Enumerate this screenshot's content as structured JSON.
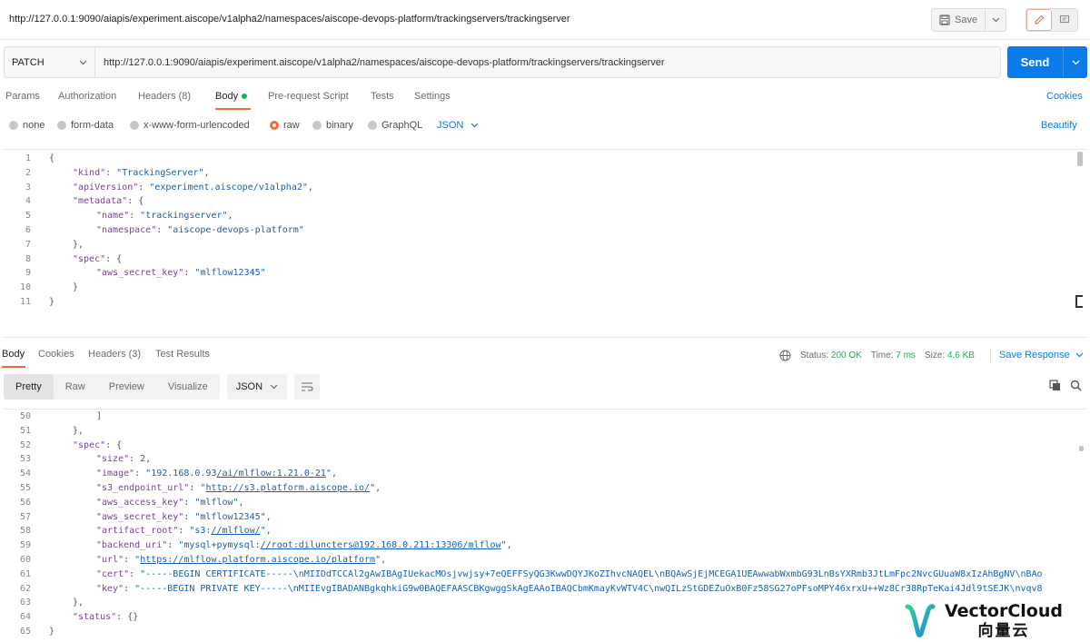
{
  "window": {
    "title": "http://127.0.0.1:9090/aiapis/experiment.aiscope/v1alpha2/namespaces/aiscope-devops-platform/trackingservers/trackingserver",
    "save_label": "Save"
  },
  "request": {
    "method": "PATCH",
    "url": "http://127.0.0.1:9090/aiapis/experiment.aiscope/v1alpha2/namespaces/aiscope-devops-platform/trackingservers/trackingserver",
    "send_label": "Send",
    "tabs": [
      "Params",
      "Authorization",
      "Headers (8)",
      "Body",
      "Pre-request Script",
      "Tests",
      "Settings"
    ],
    "active_tab": "Body",
    "cookies_label": "Cookies",
    "body_types": [
      "none",
      "form-data",
      "x-www-form-urlencoded",
      "raw",
      "binary",
      "GraphQL"
    ],
    "selected_body_type": "raw",
    "format": "JSON",
    "beautify_label": "Beautify"
  },
  "editor_lines": [
    {
      "n": "1",
      "indent": 0,
      "parts": [
        [
          "p",
          "{"
        ]
      ]
    },
    {
      "n": "2",
      "indent": 1,
      "parts": [
        [
          "k",
          "\"kind\""
        ],
        [
          "p",
          ": "
        ],
        [
          "s",
          "\"TrackingServer\""
        ],
        [
          "p",
          ","
        ]
      ]
    },
    {
      "n": "3",
      "indent": 1,
      "parts": [
        [
          "k",
          "\"apiVersion\""
        ],
        [
          "p",
          ": "
        ],
        [
          "s",
          "\"experiment.aiscope/v1alpha2\""
        ],
        [
          "p",
          ","
        ]
      ]
    },
    {
      "n": "4",
      "indent": 1,
      "parts": [
        [
          "k",
          "\"metadata\""
        ],
        [
          "p",
          ": {"
        ]
      ]
    },
    {
      "n": "5",
      "indent": 2,
      "parts": [
        [
          "k",
          "\"name\""
        ],
        [
          "p",
          ": "
        ],
        [
          "s",
          "\"trackingserver\""
        ],
        [
          "p",
          ","
        ]
      ]
    },
    {
      "n": "6",
      "indent": 2,
      "parts": [
        [
          "k",
          "\"namespace\""
        ],
        [
          "p",
          ": "
        ],
        [
          "s",
          "\"aiscope-devops-platform\""
        ]
      ]
    },
    {
      "n": "7",
      "indent": 1,
      "parts": [
        [
          "p",
          "},"
        ]
      ]
    },
    {
      "n": "8",
      "indent": 1,
      "parts": [
        [
          "k",
          "\"spec\""
        ],
        [
          "p",
          ": {"
        ]
      ]
    },
    {
      "n": "9",
      "indent": 2,
      "parts": [
        [
          "k",
          "\"aws_secret_key\""
        ],
        [
          "p",
          ": "
        ],
        [
          "s",
          "\"mlflow12345\""
        ]
      ]
    },
    {
      "n": "10",
      "indent": 1,
      "parts": [
        [
          "p",
          "}"
        ]
      ]
    },
    {
      "n": "11",
      "indent": 0,
      "parts": [
        [
          "p",
          "}"
        ]
      ]
    }
  ],
  "response": {
    "tabs": [
      "Body",
      "Cookies",
      "Headers (3)",
      "Test Results"
    ],
    "active_tab": "Body",
    "status_label": "Status:",
    "status_value": "200 OK",
    "time_label": "Time:",
    "time_value": "7 ms",
    "size_label": "Size:",
    "size_value": "4.6 KB",
    "save_response_label": "Save Response",
    "view_modes": [
      "Pretty",
      "Raw",
      "Preview",
      "Visualize"
    ],
    "active_view": "Pretty",
    "format": "JSON"
  },
  "response_lines": [
    {
      "n": "50",
      "indent": 2,
      "parts": [
        [
          "p",
          "]"
        ]
      ]
    },
    {
      "n": "51",
      "indent": 1,
      "parts": [
        [
          "p",
          "},"
        ]
      ]
    },
    {
      "n": "52",
      "indent": 1,
      "parts": [
        [
          "k",
          "\"spec\""
        ],
        [
          "p",
          ": {"
        ]
      ]
    },
    {
      "n": "53",
      "indent": 2,
      "parts": [
        [
          "k",
          "\"size\""
        ],
        [
          "p",
          ": 2,"
        ]
      ]
    },
    {
      "n": "54",
      "indent": 2,
      "parts": [
        [
          "k",
          "\"image\""
        ],
        [
          "p",
          ": "
        ],
        [
          "s",
          "\"192.168.0.93"
        ],
        [
          "u",
          "/ai/mlflow:1.21.0-21"
        ],
        [
          "s",
          "\""
        ],
        [
          "p",
          ","
        ]
      ]
    },
    {
      "n": "55",
      "indent": 2,
      "parts": [
        [
          "k",
          "\"s3_endpoint_url\""
        ],
        [
          "p",
          ": "
        ],
        [
          "s",
          "\""
        ],
        [
          "u",
          "http://s3.platform.aiscope.io/"
        ],
        [
          "s",
          "\""
        ],
        [
          "p",
          ","
        ]
      ]
    },
    {
      "n": "56",
      "indent": 2,
      "parts": [
        [
          "k",
          "\"aws_access_key\""
        ],
        [
          "p",
          ": "
        ],
        [
          "s",
          "\"mlflow\""
        ],
        [
          "p",
          ","
        ]
      ]
    },
    {
      "n": "57",
      "indent": 2,
      "parts": [
        [
          "k",
          "\"aws_secret_key\""
        ],
        [
          "p",
          ": "
        ],
        [
          "s",
          "\"mlflow12345\""
        ],
        [
          "p",
          ","
        ]
      ]
    },
    {
      "n": "58",
      "indent": 2,
      "parts": [
        [
          "k",
          "\"artifact_root\""
        ],
        [
          "p",
          ": "
        ],
        [
          "s",
          "\"s3:"
        ],
        [
          "u",
          "//mlflow/"
        ],
        [
          "s",
          "\""
        ],
        [
          "p",
          ","
        ]
      ]
    },
    {
      "n": "59",
      "indent": 2,
      "parts": [
        [
          "k",
          "\"backend_uri\""
        ],
        [
          "p",
          ": "
        ],
        [
          "s",
          "\"mysql+pymysql:"
        ],
        [
          "u",
          "//root:diluncters@192.168.0.211:13306/mlflow"
        ],
        [
          "s",
          "\""
        ],
        [
          "p",
          ","
        ]
      ]
    },
    {
      "n": "60",
      "indent": 2,
      "parts": [
        [
          "k",
          "\"url\""
        ],
        [
          "p",
          ": "
        ],
        [
          "s",
          "\""
        ],
        [
          "u",
          "https://mlflow.platform.aiscope.io/platform"
        ],
        [
          "s",
          "\""
        ],
        [
          "p",
          ","
        ]
      ]
    },
    {
      "n": "61",
      "indent": 2,
      "parts": [
        [
          "k",
          "\"cert\""
        ],
        [
          "p",
          ": "
        ],
        [
          "s",
          "\"-----BEGIN CERTIFICATE-----\\nMIIDdTCCAl2gAwIBAgIUekacMOsjvwjsy+7eQEFFSyQG3KwwDQYJKoZIhvcNAQEL\\nBQAwSjEjMCEGA1UEAwwabWxmbG93LnBsYXRmb3JtLmFpc2NvcGUuaW8xIzAhBgNV\\nBAo"
        ]
      ]
    },
    {
      "n": "62",
      "indent": 2,
      "parts": [
        [
          "k",
          "\"key\""
        ],
        [
          "p",
          ": "
        ],
        [
          "s",
          "\"-----BEGIN PRIVATE KEY-----\\nMIIEvgIBADANBgkqhkiG9w0BAQEFAASCBKgwggSkAgEAAoIBAQCbmKmayKvWTV4C\\nwQILzStGDEZuOxB0Fz58SG27oPFsoMPY46xrxU++Wz8Cr38RpTeKai4Jdl9tSEJK\\nvqv8"
        ]
      ]
    },
    {
      "n": "63",
      "indent": 1,
      "parts": [
        [
          "p",
          "},"
        ]
      ]
    },
    {
      "n": "64",
      "indent": 1,
      "parts": [
        [
          "k",
          "\"status\""
        ],
        [
          "p",
          ": {}"
        ]
      ]
    },
    {
      "n": "65",
      "indent": 0,
      "parts": [
        [
          "p",
          "}"
        ]
      ]
    }
  ],
  "watermark": {
    "brand_en": "VectorCloud",
    "brand_cn": "向量云"
  }
}
